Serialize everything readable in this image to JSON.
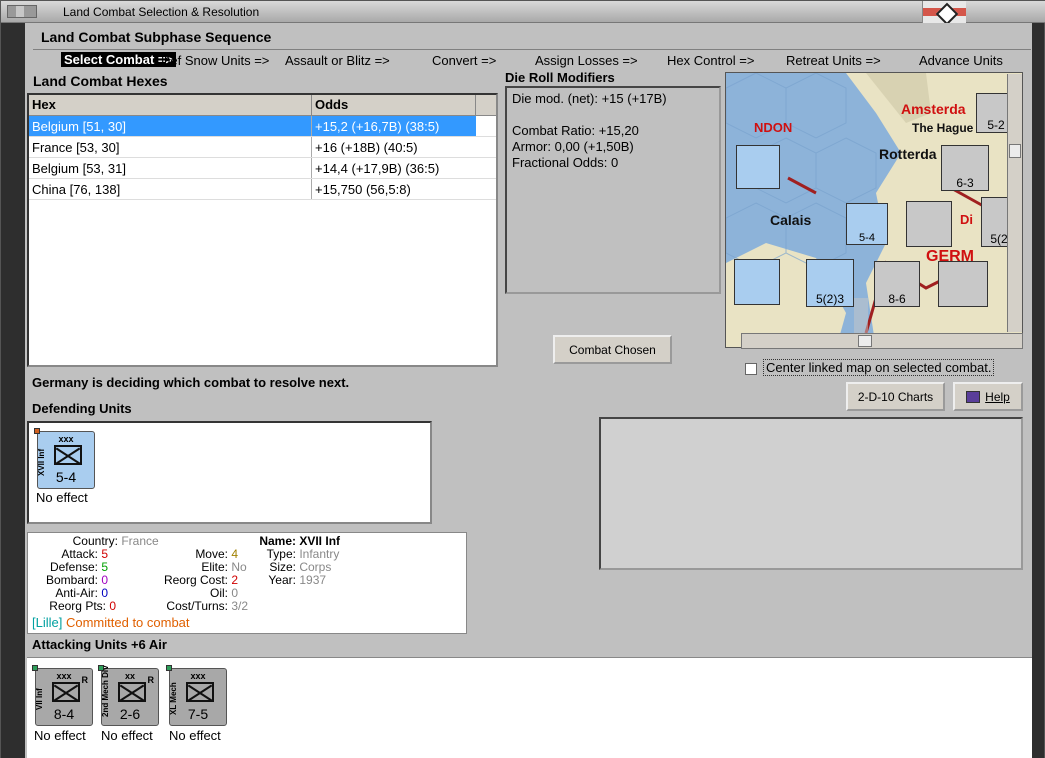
{
  "window": {
    "title": "Land Combat Selection & Resolution"
  },
  "sequence": {
    "title": "Land Combat Subphase Sequence",
    "steps": [
      "Select Combat =>",
      "Def Snow Units =>",
      "Assault or Blitz =>",
      "Convert =>",
      "Assign Losses =>",
      "Hex Control =>",
      "Retreat Units =>",
      "Advance Units"
    ]
  },
  "hexes": {
    "title": "Land Combat Hexes",
    "columns": [
      "Hex",
      "Odds"
    ],
    "rows": [
      {
        "hex": "Belgium [51, 30]",
        "odds": "+15,2 (+16,7B) (38:5)"
      },
      {
        "hex": "France [53, 30]",
        "odds": "+16 (+18B) (40:5)"
      },
      {
        "hex": "Belgium [53, 31]",
        "odds": "+14,4 (+17,9B) (36:5)"
      },
      {
        "hex": "China [76, 138]",
        "odds": "+15,750 (56,5:8)"
      }
    ]
  },
  "drm": {
    "title": "Die Roll Modifiers",
    "lines": [
      "Die mod. (net): +15 (+17B)",
      "",
      "Combat Ratio: +15,20",
      "Armor: 0,00 (+1,50B)",
      "Fractional Odds: 0"
    ]
  },
  "buttons": {
    "combat_chosen": "Combat Chosen",
    "charts": "2-D-10 Charts",
    "help": "Help"
  },
  "map": {
    "labels": [
      "Amsterda",
      "The Hague",
      "Rotterda",
      "NDON",
      "Calais",
      "Di",
      "GERM"
    ],
    "counters": [
      "5-4",
      "6-3",
      "8-6",
      "5(2)3",
      "5(2)",
      "5-2"
    ],
    "center_link_label": "Center linked map on selected combat."
  },
  "status": "Germany is deciding which combat to resolve next.",
  "defending": {
    "title": "Defending Units",
    "units": [
      {
        "name": "XVII Inf",
        "size": "xxx",
        "strength": "5-4",
        "result": "No effect"
      }
    ]
  },
  "details": {
    "country_label": "Country:",
    "country": "France",
    "attack_label": "Attack:",
    "attack": "5",
    "defense_label": "Defense:",
    "defense": "5",
    "bombard_label": "Bombard:",
    "bombard": "0",
    "antiair_label": "Anti-Air:",
    "antiair": "0",
    "reorgpts_label": "Reorg Pts:",
    "reorgpts": "0",
    "move_label": "Move:",
    "move": "4",
    "elite_label": "Elite:",
    "elite": "No",
    "reorgcost_label": "Reorg Cost:",
    "reorgcost": "2",
    "oil_label": "Oil:",
    "oil": "0",
    "costturns_label": "Cost/Turns:",
    "costturns": "3/2",
    "name_label": "Name:",
    "name": "XVII Inf",
    "type_label": "Type:",
    "type": "Infantry",
    "size_label": "Size:",
    "size": "Corps",
    "year_label": "Year:",
    "year": "1937",
    "location": "[Lille]",
    "commit_status": "Committed to combat"
  },
  "attacking": {
    "title": "Attacking Units +6 Air",
    "units": [
      {
        "name": "VII Inf",
        "size": "xxx",
        "strength": "8-4",
        "result": "No effect",
        "tag": "R"
      },
      {
        "name": "2nd Mech Div",
        "size": "xx",
        "strength": "2-6",
        "result": "No effect",
        "tag": "R"
      },
      {
        "name": "XL Mech",
        "size": "xxx",
        "strength": "7-5",
        "result": "No effect",
        "tag": ""
      }
    ]
  },
  "colors": {
    "selection": "#3399ff",
    "french_counter": "#a9cdef",
    "german_counter": "#a8a8a8",
    "panel": "#c0c0c0"
  }
}
